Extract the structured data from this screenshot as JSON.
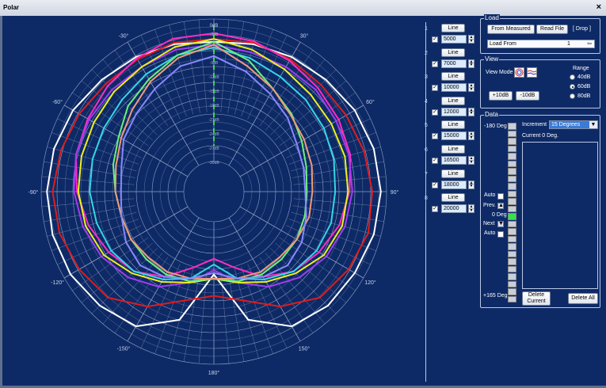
{
  "window": {
    "title": "Polar",
    "close": "×"
  },
  "polar": {
    "top_label": "0dB",
    "ring_labels": [
      "-3dB",
      "-6dB",
      "-9dB",
      "-12dB",
      "-15dB",
      "-18dB",
      "-21dB",
      "-24dB",
      "-27dB",
      "-30dB"
    ],
    "angle_labels": [
      "0°",
      "30°",
      "60°",
      "90°",
      "120°",
      "150°",
      "180°",
      "-150°",
      "-120°",
      "-90°",
      "-60°",
      "-30°"
    ],
    "colors": {
      "grid": "#8ea0c4",
      "marker": "#3dd64a"
    }
  },
  "channels": [
    {
      "index": "1",
      "button": "Line",
      "value": "5000",
      "checked": true
    },
    {
      "index": "2",
      "button": "Line",
      "value": "7000",
      "checked": true
    },
    {
      "index": "3",
      "button": "Line",
      "value": "10000",
      "checked": true
    },
    {
      "index": "4",
      "button": "Line",
      "value": "12000",
      "checked": true
    },
    {
      "index": "5",
      "button": "Line",
      "value": "15000",
      "checked": true
    },
    {
      "index": "6",
      "button": "Line",
      "value": "16500",
      "checked": true
    },
    {
      "index": "7",
      "button": "Line",
      "value": "18000",
      "checked": true
    },
    {
      "index": "8",
      "button": "Line",
      "value": "20000",
      "checked": true
    }
  ],
  "load": {
    "title": "Load",
    "from_measured": "From Measured",
    "read_file": "Read File",
    "drop": "[ Drop ]",
    "load_from_label": "Load From",
    "load_from_value": "1"
  },
  "view": {
    "title": "View",
    "mode_label": "View Mode",
    "range_label": "Range",
    "range_options": [
      "40dB",
      "60dB",
      "80dB"
    ],
    "range_selected": "60dB",
    "plus_button": "+10dB",
    "minus_button": "-10dB"
  },
  "data": {
    "title": "Data",
    "top_deg": "-180 Deg",
    "bottom_deg": "+165 Deg",
    "auto1": "Auto",
    "prev": "Prev.",
    "zero_deg": "0 Deg",
    "next": "Next",
    "auto2": "Auto",
    "increment_label": "Increment",
    "increment_value": "15 Degrees",
    "current_label": "Current 0 Deg.",
    "delete_current": "Delete Current",
    "delete_all": "Delete All"
  },
  "traces": [
    {
      "name": "white",
      "color": "#ffffff",
      "r": [
        0.84,
        0.86,
        0.88,
        0.9,
        0.93,
        0.95,
        0.96,
        0.95,
        0.93,
        0.92,
        0.88,
        0.72,
        0.37,
        0.72,
        0.88,
        0.92,
        0.95,
        0.96,
        0.96,
        0.95,
        0.93,
        0.9,
        0.88,
        0.86
      ]
    },
    {
      "name": "red",
      "color": "#e01c1c",
      "r": [
        0.86,
        0.87,
        0.86,
        0.85,
        0.86,
        0.88,
        0.9,
        0.91,
        0.88,
        0.84,
        0.72,
        0.58,
        0.52,
        0.58,
        0.72,
        0.84,
        0.88,
        0.91,
        0.92,
        0.9,
        0.88,
        0.86,
        0.86,
        0.87
      ]
    },
    {
      "name": "magenta",
      "color": "#ff2cc2",
      "r": [
        0.9,
        0.88,
        0.85,
        0.82,
        0.8,
        0.78,
        0.74,
        0.7,
        0.64,
        0.58,
        0.48,
        0.34,
        0.26,
        0.34,
        0.48,
        0.58,
        0.64,
        0.7,
        0.75,
        0.79,
        0.81,
        0.84,
        0.87,
        0.9
      ]
    },
    {
      "name": "purple",
      "color": "#a23cf0",
      "r": [
        0.82,
        0.8,
        0.8,
        0.8,
        0.78,
        0.77,
        0.76,
        0.74,
        0.7,
        0.64,
        0.56,
        0.45,
        0.34,
        0.45,
        0.56,
        0.64,
        0.7,
        0.74,
        0.77,
        0.79,
        0.8,
        0.8,
        0.8,
        0.82
      ]
    },
    {
      "name": "yellow",
      "color": "#f0f01e",
      "r": [
        0.86,
        0.82,
        0.78,
        0.75,
        0.74,
        0.74,
        0.73,
        0.72,
        0.68,
        0.6,
        0.52,
        0.45,
        0.4,
        0.45,
        0.52,
        0.6,
        0.68,
        0.72,
        0.74,
        0.75,
        0.76,
        0.78,
        0.8,
        0.84
      ]
    },
    {
      "name": "cyan",
      "color": "#34d6e8",
      "r": [
        0.8,
        0.76,
        0.72,
        0.7,
        0.68,
        0.66,
        0.64,
        0.64,
        0.62,
        0.58,
        0.5,
        0.42,
        0.3,
        0.42,
        0.5,
        0.58,
        0.62,
        0.64,
        0.66,
        0.67,
        0.68,
        0.7,
        0.74,
        0.78
      ]
    },
    {
      "name": "green",
      "color": "#6cf07a",
      "r": [
        0.84,
        0.74,
        0.62,
        0.56,
        0.5,
        0.46,
        0.44,
        0.45,
        0.46,
        0.46,
        0.46,
        0.44,
        0.4,
        0.44,
        0.46,
        0.46,
        0.46,
        0.46,
        0.48,
        0.52,
        0.56,
        0.64,
        0.7,
        0.78
      ]
    },
    {
      "name": "salmon",
      "color": "#f09a7a",
      "r": [
        0.82,
        0.7,
        0.62,
        0.55,
        0.52,
        0.5,
        0.48,
        0.48,
        0.46,
        0.44,
        0.44,
        0.42,
        0.4,
        0.42,
        0.44,
        0.44,
        0.46,
        0.46,
        0.48,
        0.5,
        0.54,
        0.6,
        0.68,
        0.76
      ]
    },
    {
      "name": "violet",
      "color": "#8888ff",
      "r": [
        0.74,
        0.66,
        0.58,
        0.52,
        0.46,
        0.44,
        0.43,
        0.46,
        0.5,
        0.52,
        0.48,
        0.42,
        0.36,
        0.42,
        0.48,
        0.52,
        0.5,
        0.46,
        0.44,
        0.46,
        0.52,
        0.56,
        0.62,
        0.7
      ]
    }
  ]
}
